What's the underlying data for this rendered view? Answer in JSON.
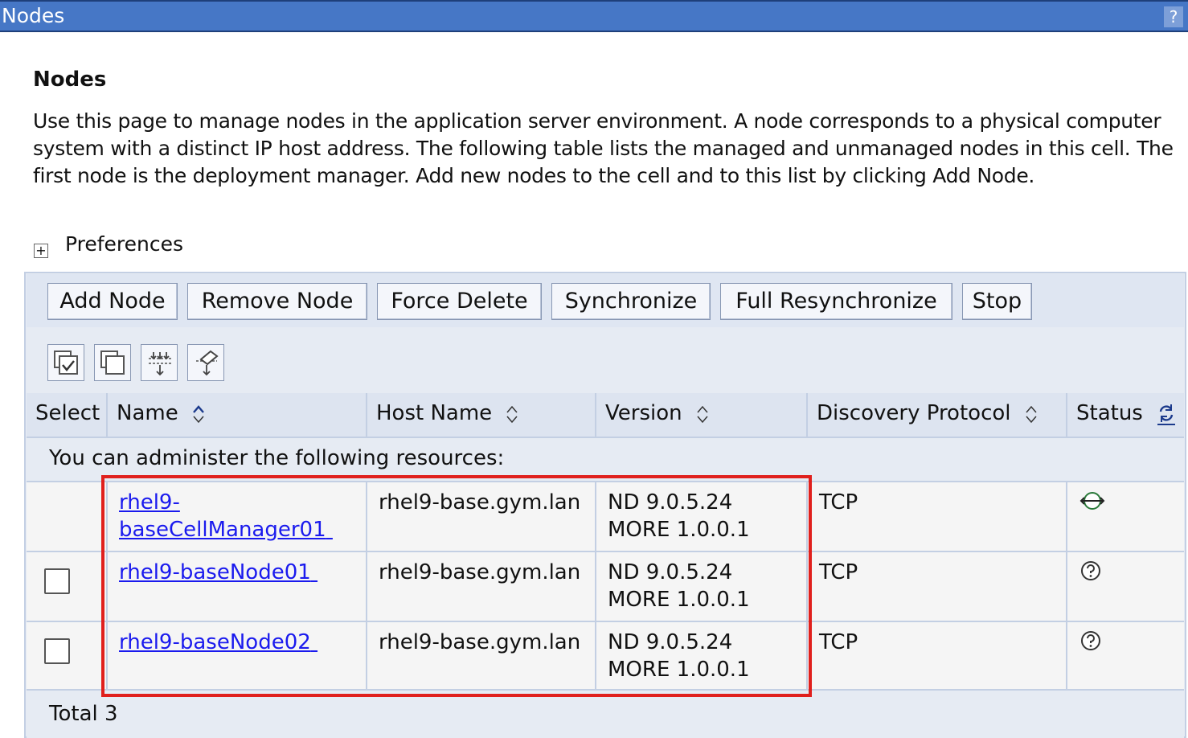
{
  "window": {
    "title": "Nodes",
    "help_label": "?"
  },
  "page": {
    "heading": "Nodes",
    "description": "Use this page to manage nodes in the application server environment. A node corresponds to a physical computer system with a distinct IP host address. The following table lists the managed and unmanaged nodes in this cell. The first node is the deployment manager. Add new nodes to the cell and to this list by clicking Add Node."
  },
  "preferences": {
    "label": "Preferences",
    "expander": "+"
  },
  "toolbar": {
    "add_node": "Add Node",
    "remove_node": "Remove Node",
    "force_delete": "Force Delete",
    "synchronize": "Synchronize",
    "full_resynchronize": "Full Resynchronize",
    "stop": "Stop"
  },
  "icon_toolbar": [
    "select-all-icon",
    "deselect-all-icon",
    "show-filter-icon",
    "clear-filter-icon"
  ],
  "table": {
    "headers": {
      "select": "Select",
      "name": "Name",
      "host_name": "Host Name",
      "version": "Version",
      "discovery_protocol": "Discovery Protocol",
      "status": "Status"
    },
    "resources_caption": "You can administer the following resources:",
    "rows": [
      {
        "name_line1": "rhel9-",
        "name_line2": "baseCellManager01",
        "host": "rhel9-base.gym.lan",
        "version_line1": "ND 9.0.5.24",
        "version_line2": "MORE 1.0.0.1",
        "protocol": "TCP",
        "status_icon": "deployment-manager-status-icon",
        "selectable": false
      },
      {
        "name_line1": "rhel9-baseNode01",
        "name_line2": "",
        "host": "rhel9-base.gym.lan",
        "version_line1": "ND 9.0.5.24",
        "version_line2": "MORE 1.0.0.1",
        "protocol": "TCP",
        "status_icon": "unknown-status-icon",
        "selectable": true
      },
      {
        "name_line1": "rhel9-baseNode02",
        "name_line2": "",
        "host": "rhel9-base.gym.lan",
        "version_line1": "ND 9.0.5.24",
        "version_line2": "MORE 1.0.0.1",
        "protocol": "TCP",
        "status_icon": "unknown-status-icon",
        "selectable": true
      }
    ],
    "total": "Total 3"
  },
  "colors": {
    "titlebar": "#4677c6",
    "link": "#1a1aee",
    "highlight": "#e0201d"
  }
}
